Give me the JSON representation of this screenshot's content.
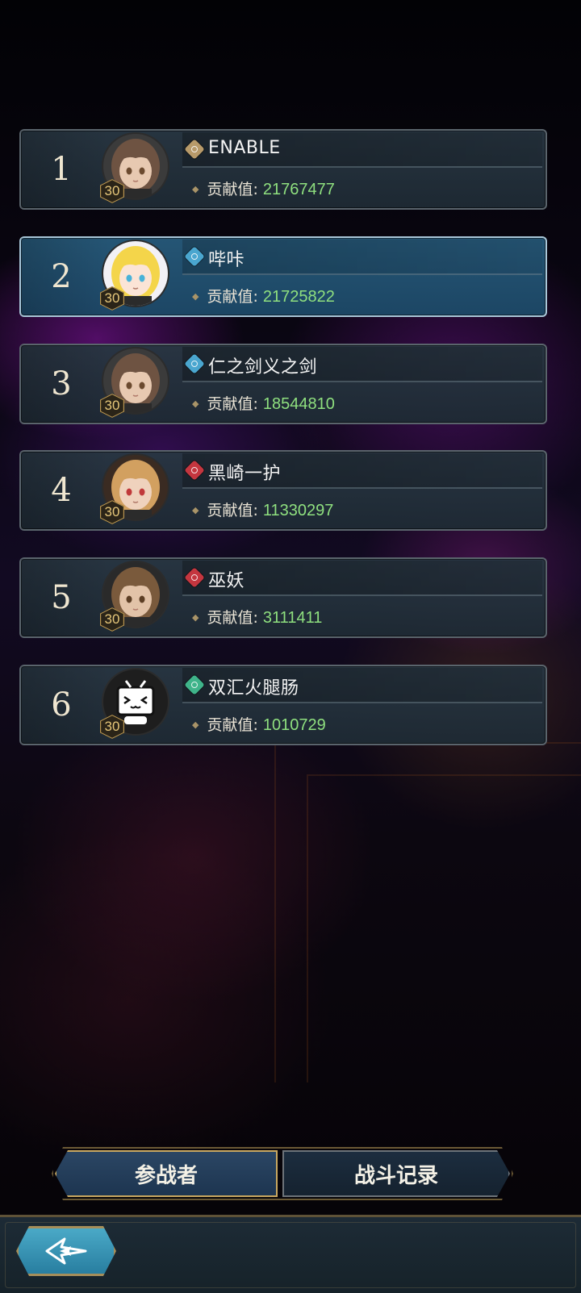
{
  "label_contribution": "贡献值:",
  "players": [
    {
      "rank": "1",
      "name": "ENABLE",
      "level": "30",
      "contribution": "21767477",
      "element_color": "#b79a6a",
      "selected": false,
      "avatar": "brown-hair-girl"
    },
    {
      "rank": "2",
      "name": "哔咔",
      "level": "30",
      "contribution": "21725822",
      "element_color": "#4aa6cf",
      "selected": true,
      "avatar": "blonde-anime-girl"
    },
    {
      "rank": "3",
      "name": "仁之剑义之剑",
      "level": "30",
      "contribution": "18544810",
      "element_color": "#4aa6cf",
      "selected": false,
      "avatar": "brown-hair-girl"
    },
    {
      "rank": "4",
      "name": "黑崎一护",
      "level": "30",
      "contribution": "11330297",
      "element_color": "#c4363f",
      "selected": false,
      "avatar": "blonde-red-eyes-girl"
    },
    {
      "rank": "5",
      "name": "巫妖",
      "level": "30",
      "contribution": "3111411",
      "element_color": "#c4363f",
      "selected": false,
      "avatar": "brown-hair-boy"
    },
    {
      "rank": "6",
      "name": "双汇火腿肠",
      "level": "30",
      "contribution": "1010729",
      "element_color": "#3fb48a",
      "selected": false,
      "avatar": "tv-mascot"
    }
  ],
  "tabs": {
    "participants": "参战者",
    "battle_log": "战斗记录"
  },
  "back_icon": "back-arrow-icon"
}
